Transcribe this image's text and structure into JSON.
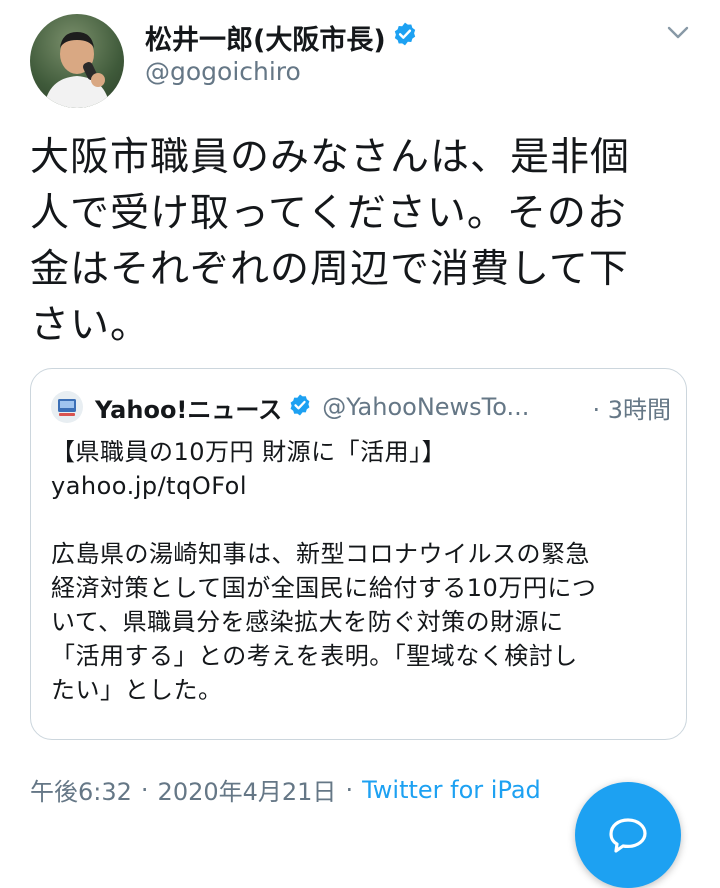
{
  "tweet": {
    "author": {
      "display_name": "松井一郎(大阪市長)",
      "handle": "@gogoichiro",
      "verified": true
    },
    "text_lines": [
      "大阪市職員のみなさんは、是非個",
      "人で受け取ってください。そのお",
      "金はそれぞれの周辺で消費して下",
      "さい。"
    ],
    "quoted": {
      "display_name": "Yahoo!ニュース",
      "handle": "@YahooNewsTo...",
      "time": "· 3時間",
      "headline": "【県職員の10万円 財源に「活用」】",
      "link": "yahoo.jp/tqOFol",
      "body_lines": [
        "広島県の湯崎知事は、新型コロナウイルスの緊急",
        "経済対策として国が全国民に給付する10万円につ",
        "いて、県職員分を感染拡大を防ぐ対策の財源に",
        "「活用する」との考えを表明。「聖域なく検討し",
        "たい」とした。"
      ]
    },
    "meta": {
      "time": "午後6:32",
      "separator_1": "·",
      "date": "2020年4月21日",
      "separator_2": "·",
      "source": "Twitter for iPad"
    }
  },
  "colors": {
    "accent": "#1da1f2",
    "text": "#14171a",
    "secondary": "#657786",
    "border": "#ccd6dd"
  },
  "icons": {
    "verified": "verified-badge-icon",
    "menu": "chevron-down-icon",
    "compose": "compose-reply-icon"
  }
}
